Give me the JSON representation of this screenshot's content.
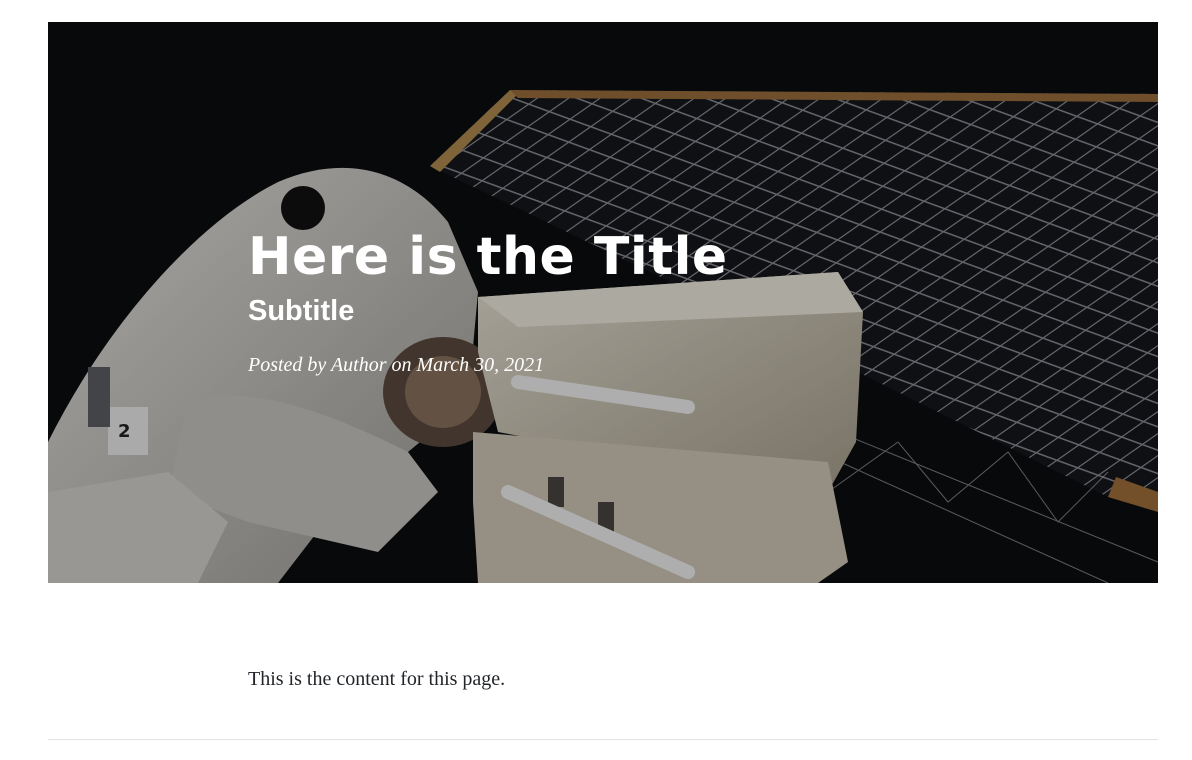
{
  "header": {
    "title": "Here is the Title",
    "subtitle": "Subtitle",
    "meta": "Posted by Author on March 30, 2021"
  },
  "main": {
    "content": "This is the content for this page."
  },
  "colors": {
    "text": "#212529",
    "hero_text": "#ffffff",
    "divider": "#e3e3e3"
  }
}
